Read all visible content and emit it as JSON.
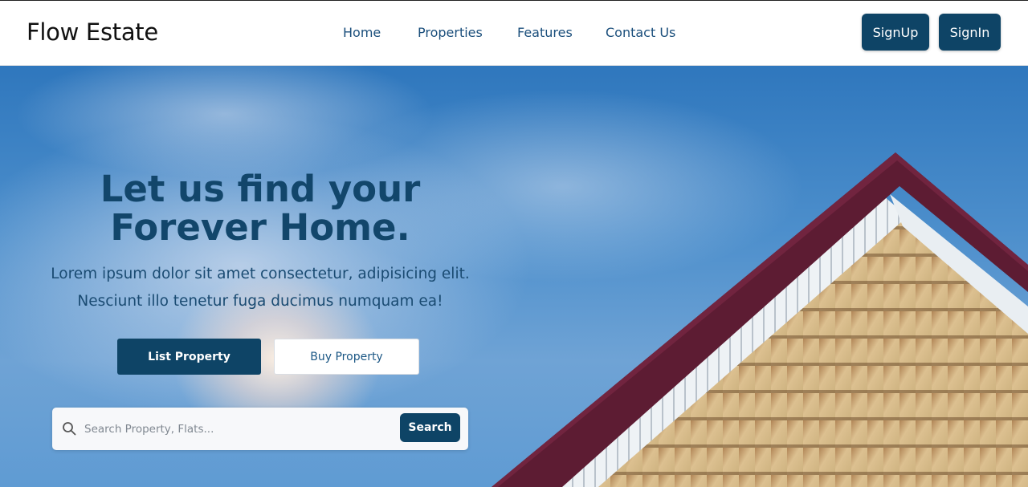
{
  "header": {
    "brand": "Flow Estate",
    "nav": [
      "Home",
      "Properties",
      "Features",
      "Contact Us"
    ],
    "signup_label": "SignUp",
    "signin_label": "SignIn"
  },
  "hero": {
    "title": "Let us find your\nForever Home.",
    "subtitle": "Lorem ipsum dolor sit amet consectetur, adipisicing elit. Nesciunt illo tenetur fuga ducimus numquam ea!",
    "list_property_label": "List Property",
    "buy_property_label": "Buy Property"
  },
  "search": {
    "placeholder": "Search Property, Flats...",
    "button_label": "Search"
  },
  "colors": {
    "primary": "#0e4466",
    "nav_text": "#1b4f7c",
    "title_text": "#12466b"
  },
  "icons": {
    "search": "search-icon"
  }
}
